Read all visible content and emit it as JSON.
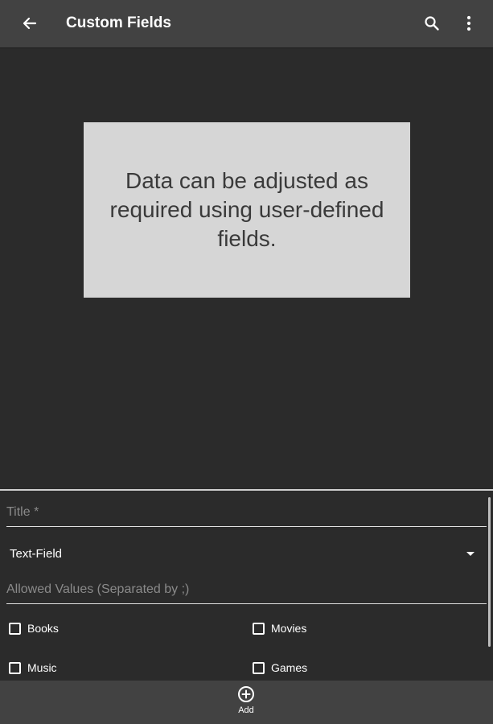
{
  "appbar": {
    "title": "Custom Fields",
    "icons": {
      "back": "arrow-left-icon",
      "search": "search-icon",
      "more": "more-vert-icon"
    }
  },
  "info_card": {
    "text": "Data can be adjusted as required using user-defined fields."
  },
  "form": {
    "title_placeholder": "Title *",
    "type_select": {
      "value": "Text-Field",
      "icon": "dropdown-caret-icon"
    },
    "allowed_values_placeholder": "Allowed Values (Separated by ;)",
    "categories": [
      {
        "label": "Books",
        "checked": false
      },
      {
        "label": "Movies",
        "checked": false
      },
      {
        "label": "Music",
        "checked": false
      },
      {
        "label": "Games",
        "checked": false
      }
    ]
  },
  "bottombar": {
    "add_label": "Add",
    "add_icon": "add-circle-icon"
  },
  "colors": {
    "appbar_bg": "#424242",
    "page_bg": "#2b2b2b",
    "card_bg": "#d6d6d6",
    "card_text": "#3a3a3a",
    "placeholder": "#8a8a8a"
  }
}
